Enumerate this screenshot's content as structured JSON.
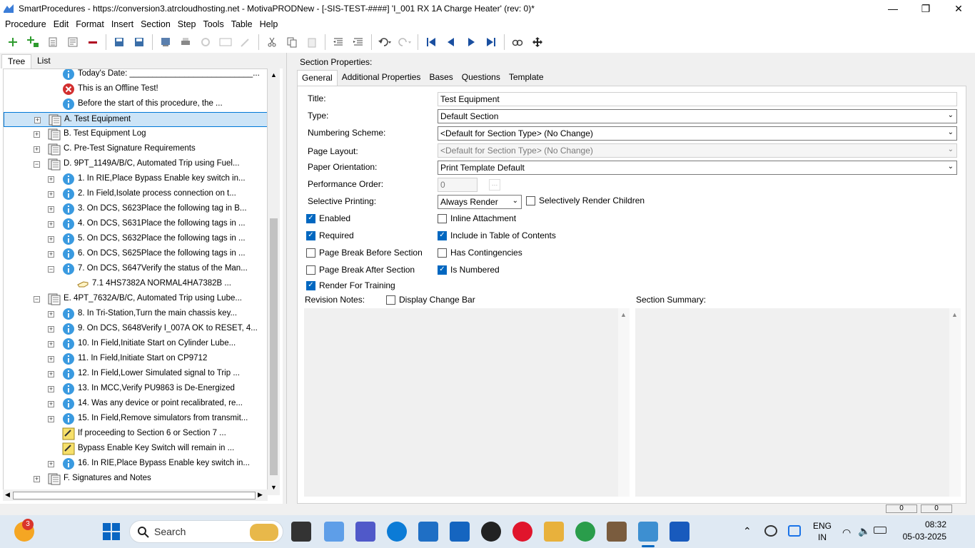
{
  "window": {
    "title": "SmartProcedures - https://conversion3.atrcloudhosting.net - MotivaPRODNew - [-SIS-TEST-####] 'I_001 RX 1A Charge Heater' (rev: 0)*",
    "minimize": "—",
    "maximize": "❐",
    "close": "✕"
  },
  "menu": [
    "Procedure",
    "Edit",
    "Format",
    "Insert",
    "Section",
    "Step",
    "Tools",
    "Table",
    "Help"
  ],
  "left_tabs": [
    "Tree",
    "List"
  ],
  "tree": [
    {
      "text": "Today's Date: ___________________________...",
      "icon": "info-icon"
    },
    {
      "text": "This is an Offline Test!",
      "icon": "error-icon"
    },
    {
      "text": "Before the start of this procedure, the ...",
      "icon": "info-icon"
    },
    {
      "text": "A. Test Equipment",
      "icon": "section-icon"
    },
    {
      "text": "B. Test Equipment Log",
      "icon": "section-icon"
    },
    {
      "text": "C. Pre-Test Signature Requirements",
      "icon": "section-icon"
    },
    {
      "text": "D. 9PT_1149A/B/C, Automated Trip using Fuel...",
      "icon": "section-icon"
    },
    {
      "text": "1. In RIE,Place Bypass Enable key switch in...",
      "icon": "info-icon"
    },
    {
      "text": "2. In Field,Isolate process connection on t...",
      "icon": "info-icon"
    },
    {
      "text": "3. On DCS, S623Place the following tag in B...",
      "icon": "info-icon"
    },
    {
      "text": "4. On DCS, S631Place the following tags in ...",
      "icon": "info-icon"
    },
    {
      "text": "5. On DCS, S632Place the following tags in ...",
      "icon": "info-icon"
    },
    {
      "text": "6. On DCS, S625Place the following tags in ...",
      "icon": "info-icon"
    },
    {
      "text": "7. On DCS, S647Verify the status of the Man...",
      "icon": "info-icon"
    },
    {
      "text": "7.1 4HS7382A        NORMAL4HA7382B        ...",
      "icon": "hand-icon"
    },
    {
      "text": "E. 4PT_7632A/B/C, Automated Trip using Lube...",
      "icon": "section-icon"
    },
    {
      "text": "8. In Tri-Station,Turn the main chassis key...",
      "icon": "info-icon"
    },
    {
      "text": "9. On DCS, S648Verify I_007A OK to RESET, 4...",
      "icon": "info-icon"
    },
    {
      "text": "10. In Field,Initiate Start on Cylinder Lube...",
      "icon": "info-icon"
    },
    {
      "text": "11. In Field,Initiate Start on CP9712",
      "icon": "info-icon"
    },
    {
      "text": "12. In Field,Lower Simulated signal to Trip ...",
      "icon": "info-icon"
    },
    {
      "text": "13. In MCC,Verify PU9863 is De-Energized",
      "icon": "info-icon"
    },
    {
      "text": "14. Was any device or point recalibrated, re...",
      "icon": "info-icon"
    },
    {
      "text": "15. In Field,Remove simulators from transmit...",
      "icon": "info-icon"
    },
    {
      "text": "If proceeding to Section 6 or Section 7 ...",
      "icon": "note-icon"
    },
    {
      "text": "Bypass Enable Key Switch will remain in ...",
      "icon": "note-icon"
    },
    {
      "text": "16. In RIE,Place Bypass Enable key switch in...",
      "icon": "info-icon"
    },
    {
      "text": "F. Signatures and Notes",
      "icon": "section-icon"
    }
  ],
  "right": {
    "section_properties_label": "Section Properties:",
    "tabs": [
      "General",
      "Additional Properties",
      "Bases",
      "Questions",
      "Template"
    ],
    "fields": {
      "title_label": "Title:",
      "title_value": "Test Equipment",
      "type_label": "Type:",
      "type_value": "Default Section",
      "numbering_label": "Numbering Scheme:",
      "numbering_value": "<Default for Section Type> (No Change)",
      "layout_label": "Page Layout:",
      "layout_value": "<Default for Section Type> (No Change)",
      "orientation_label": "Paper Orientation:",
      "orientation_value": "Print Template Default",
      "perf_label": "Performance Order:",
      "perf_value": "0",
      "selective_label": "Selective Printing:",
      "selective_value": "Always Render"
    },
    "checkboxes": {
      "selectively_render_children": "Selectively Render Children",
      "enabled": "Enabled",
      "inline_attachment": "Inline Attachment",
      "required": "Required",
      "include_toc": "Include in Table of Contents",
      "page_break_before": "Page Break Before Section",
      "has_contingencies": "Has Contingencies",
      "page_break_after": "Page Break After Section",
      "is_numbered": "Is Numbered",
      "render_for_training": "Render For Training",
      "display_change_bar": "Display Change Bar"
    },
    "revision_notes_label": "Revision Notes:",
    "section_summary_label": "Section Summary:"
  },
  "status": {
    "box1": "0",
    "box2": "0"
  },
  "taskbar": {
    "search_placeholder": "Search",
    "badge": "3",
    "lang_top": "ENG",
    "lang_bottom": "IN",
    "time": "08:32",
    "date": "05-03-2025"
  }
}
